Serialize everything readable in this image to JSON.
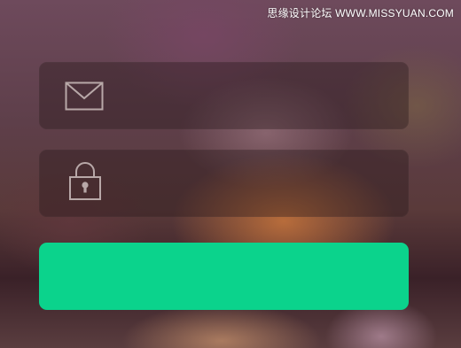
{
  "watermark": {
    "text": "思缘设计论坛  WWW.MISSYUAN.COM"
  },
  "form": {
    "email": {
      "icon": "envelope-icon",
      "value": "",
      "placeholder": ""
    },
    "password": {
      "icon": "padlock-icon",
      "value": "",
      "placeholder": ""
    },
    "submit": {
      "label": ""
    }
  },
  "colors": {
    "submit_button": "#0bd38c",
    "field_background": "rgba(40,24,26,0.38)",
    "icon_stroke": "#b8a8a8"
  }
}
